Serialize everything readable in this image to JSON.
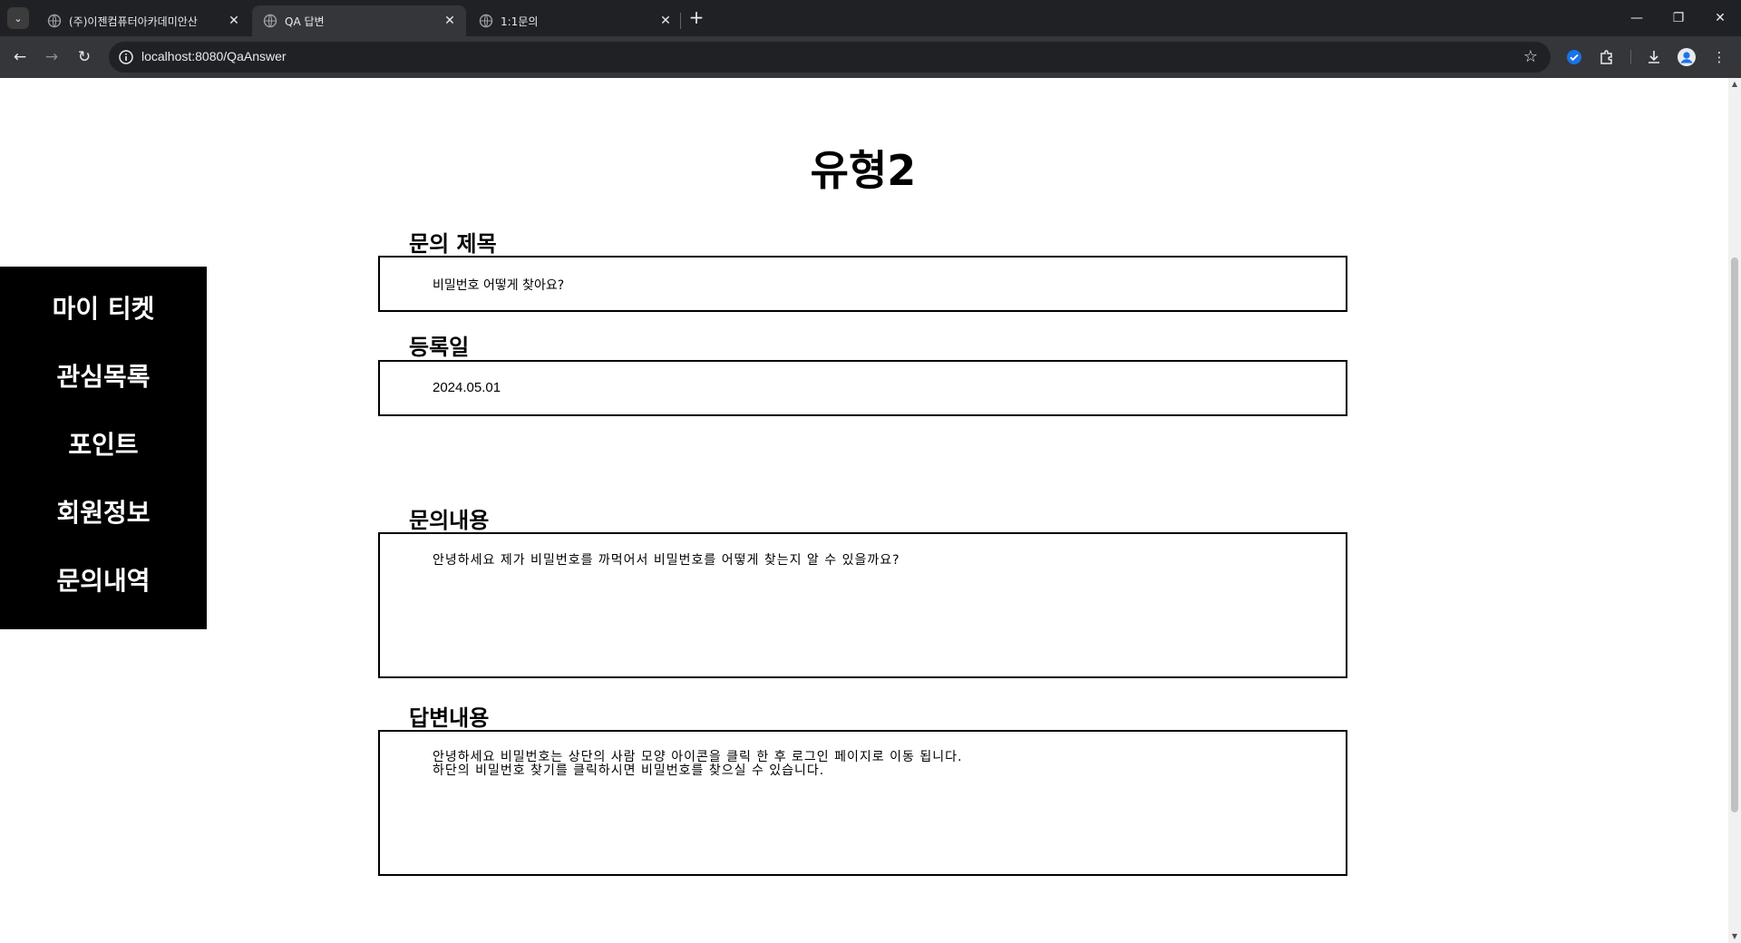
{
  "browser": {
    "tabs": [
      {
        "title": "(주)이젠컴퓨터아카데미안산",
        "active": false
      },
      {
        "title": "QA 답변",
        "active": true
      },
      {
        "title": "1:1문의",
        "active": false
      }
    ],
    "url": "localhost:8080/QaAnswer"
  },
  "page": {
    "title": "유형2",
    "sidebar": {
      "items": [
        "마이 티켓",
        "관심목록",
        "포인트",
        "회원정보",
        "문의내역"
      ]
    },
    "sections": {
      "subject_label": "문의 제목",
      "subject_value": "비밀번호 어떻게 찾아요?",
      "date_label": "등록일",
      "date_value": "2024.05.01",
      "content_label": "문의내용",
      "content_value": "안녕하세요 제가 비밀번호를 까먹어서 비밀번호를 어떻게 찾는지 알 수 있을까요?",
      "answer_label": "답변내용",
      "answer_line1": "안녕하세요 비밀번호는 상단의 사람 모양 아이콘을 클릭 한 후 로그인 페이지로 이동 됩니다.",
      "answer_line2": "하단의 비밀번호 찾기를 클릭하시면 비밀번호를 찾으실 수 있습니다."
    }
  }
}
